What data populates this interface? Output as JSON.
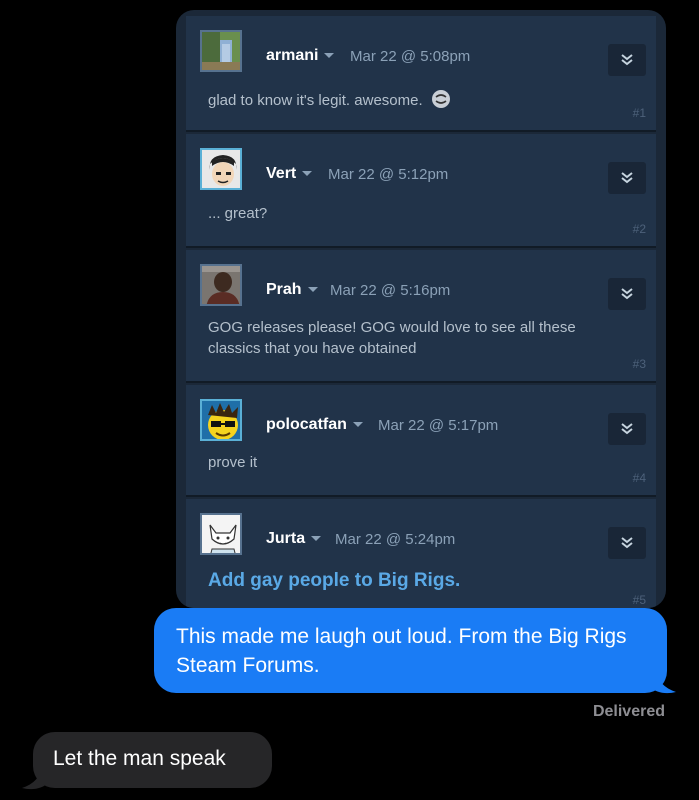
{
  "forum_posts": [
    {
      "user": "armani",
      "date": "Mar 22 @ 5:08pm",
      "text": "glad to know it's legit. awesome.",
      "num": "#1",
      "emoticon": "smiley-emoticon"
    },
    {
      "user": "Vert",
      "date": "Mar 22 @ 5:12pm",
      "text": "... great?",
      "num": "#2"
    },
    {
      "user": "Prah",
      "date": "Mar 22 @ 5:16pm",
      "text": "GOG releases please! GOG would love to see all these classics that you have obtained",
      "num": "#3"
    },
    {
      "user": "polocatfan",
      "date": "Mar 22 @ 5:17pm",
      "text": "prove it",
      "num": "#4"
    },
    {
      "user": "Jurta",
      "date": "Mar 22 @ 5:24pm",
      "text": "Add gay people to Big Rigs.",
      "num": "#5"
    }
  ],
  "messages": {
    "sent": "This made me laugh out loud. From the Big Rigs Steam Forums.",
    "status": "Delivered",
    "received": "Let the man speak"
  },
  "colors": {
    "sent_bubble": "#1a7cf5",
    "received_bubble": "#262628",
    "forum_bg": "#213349"
  }
}
